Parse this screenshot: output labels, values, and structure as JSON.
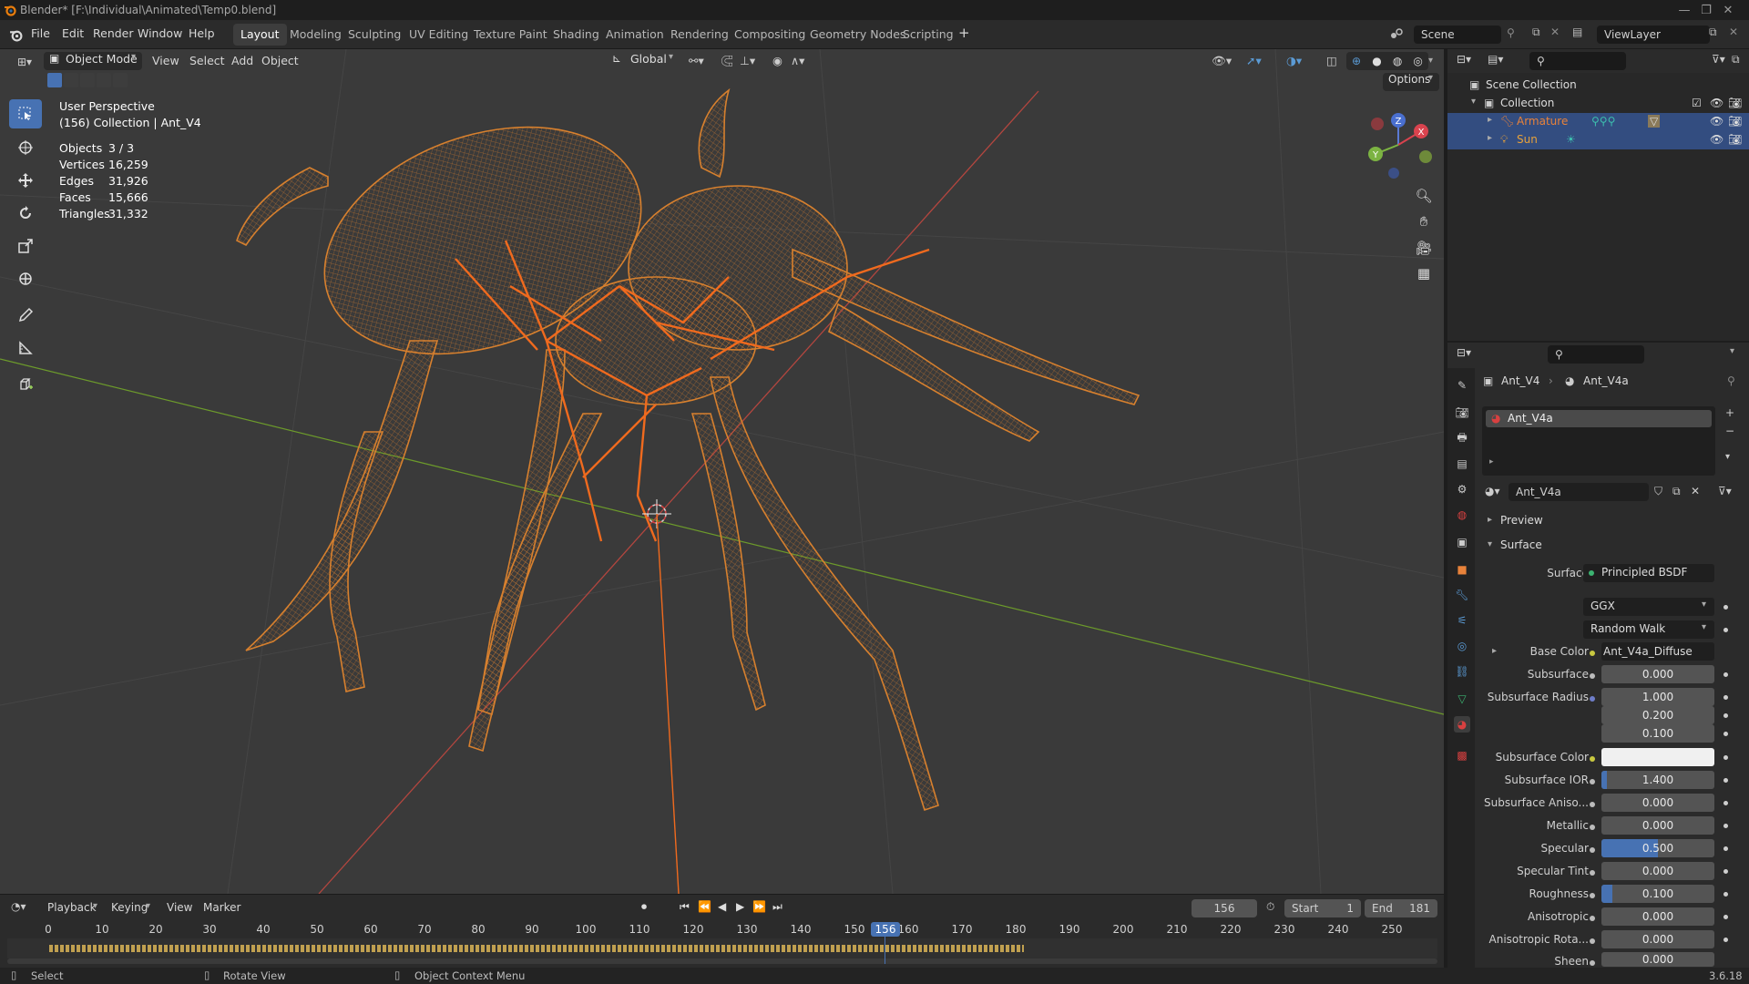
{
  "window": {
    "title": "Blender* [F:\\Individual\\Animated\\Temp0.blend]",
    "controls": [
      "—",
      "❐",
      "✕"
    ]
  },
  "menu": [
    "File",
    "Edit",
    "Render",
    "Window",
    "Help"
  ],
  "workspaces": [
    "Layout",
    "Modeling",
    "Sculpting",
    "UV Editing",
    "Texture Paint",
    "Shading",
    "Animation",
    "Rendering",
    "Compositing",
    "Geometry Nodes",
    "Scripting"
  ],
  "active_workspace": "Layout",
  "scene": {
    "name": "Scene",
    "view_layer": "ViewLayer"
  },
  "viewport_header": {
    "mode": "Object Mode",
    "menus": [
      "View",
      "Select",
      "Add",
      "Object"
    ],
    "transform_orientation": "Global",
    "options_label": "Options"
  },
  "viewport": {
    "view_name": "User Perspective",
    "collection_info": "(156) Collection | Ant_V4",
    "stats": [
      {
        "label": "Objects",
        "value": "3 / 3"
      },
      {
        "label": "Vertices",
        "value": "16,259"
      },
      {
        "label": "Edges",
        "value": "31,926"
      },
      {
        "label": "Faces",
        "value": "15,666"
      },
      {
        "label": "Triangles",
        "value": "31,332"
      }
    ],
    "gizmo_axes": {
      "x": "X",
      "y": "Y",
      "z": "Z"
    },
    "wire_color": "#d7802e",
    "bone_color": "#f06a1e"
  },
  "outliner": {
    "root": "Scene Collection",
    "collection": "Collection",
    "items": [
      {
        "name": "Armature",
        "color": "#e8823a"
      },
      {
        "name": "Sun",
        "color": "#e8a23a"
      }
    ]
  },
  "properties": {
    "breadcrumb": [
      "Ant_V4",
      "Ant_V4a"
    ],
    "material_slot": "Ant_V4a",
    "material_name": "Ant_V4a",
    "panels": {
      "preview": "Preview",
      "surface": "Surface"
    },
    "surface_shader_label": "Surface",
    "surface_shader": "Principled BSDF",
    "distribution": "GGX",
    "subsurface_method": "Random Walk",
    "fields": [
      {
        "label": "Base Color",
        "value": "Ant_V4a_Diffuse",
        "dot": "#c8c840"
      },
      {
        "label": "Subsurface",
        "value": "0.000"
      },
      {
        "label": "Subsurface Radius",
        "value": "1.000",
        "dot": "#6e7dc8"
      },
      {
        "label": "",
        "value": "0.200"
      },
      {
        "label": "",
        "value": "0.100"
      },
      {
        "label": "Subsurface Color",
        "value": "",
        "dot": "#c8c840"
      },
      {
        "label": "Subsurface IOR",
        "value": "1.400",
        "fill": 0.05
      },
      {
        "label": "Subsurface Aniso...",
        "value": "0.000"
      },
      {
        "label": "Metallic",
        "value": "0.000"
      },
      {
        "label": "Specular",
        "value": "0.500",
        "fill": 0.5
      },
      {
        "label": "Specular Tint",
        "value": "0.000"
      },
      {
        "label": "Roughness",
        "value": "0.100",
        "fill": 0.1
      },
      {
        "label": "Anisotropic",
        "value": "0.000"
      },
      {
        "label": "Anisotropic Rota...",
        "value": "0.000"
      },
      {
        "label": "Sheen",
        "value": "0.000"
      }
    ]
  },
  "timeline": {
    "menus": [
      "Playback",
      "Keying",
      "View",
      "Marker"
    ],
    "current_frame": "156",
    "start_label": "Start",
    "start": "1",
    "end_label": "End",
    "end": "181",
    "ruler": [
      "0",
      "10",
      "20",
      "30",
      "40",
      "50",
      "60",
      "70",
      "80",
      "90",
      "100",
      "110",
      "120",
      "130",
      "140",
      "150",
      "156",
      "160",
      "170",
      "180",
      "190",
      "200",
      "210",
      "220",
      "230",
      "240",
      "250"
    ],
    "accent": "#4772b3"
  },
  "statusbar": {
    "select": "Select",
    "rotate": "Rotate View",
    "context": "Object Context Menu",
    "version": "3.6.18"
  }
}
